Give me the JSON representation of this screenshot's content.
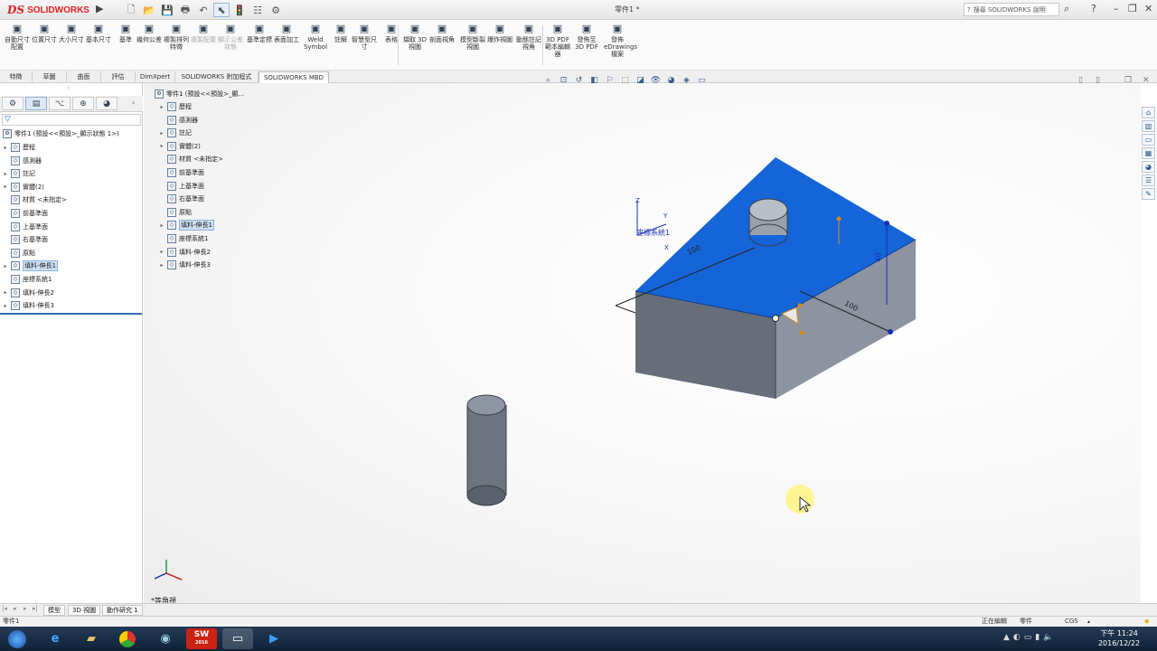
{
  "app": {
    "brand_ds": "DS",
    "brand_name": "SOLIDWORKS",
    "document_title": "零件1 *"
  },
  "search": {
    "placeholder": "搜尋 SOLIDWORKS 說明"
  },
  "command_manager": {
    "items": [
      {
        "label": "自動尺寸配置",
        "icon": "auto-dimension-icon",
        "enabled": true
      },
      {
        "label": "位置尺寸",
        "icon": "location-dimension-icon",
        "enabled": true
      },
      {
        "label": "大小尺寸",
        "icon": "size-dimension-icon",
        "enabled": true
      },
      {
        "label": "基本尺寸",
        "icon": "basic-dimension-icon",
        "enabled": true
      },
      {
        "label": "基準",
        "icon": "datum-icon",
        "enabled": true
      },
      {
        "label": "幾何公差",
        "icon": "geometric-tolerance-icon",
        "enabled": true
      },
      {
        "label": "複製排列特徵",
        "icon": "pattern-feature-icon",
        "enabled": true
      },
      {
        "label": "複製配置",
        "icon": "copy-scheme-icon",
        "enabled": false
      },
      {
        "label": "顯示公差狀態",
        "icon": "tolerance-status-icon",
        "enabled": false
      },
      {
        "label": "基準定標",
        "icon": "datum-target-icon",
        "enabled": true
      },
      {
        "label": "表面加工",
        "icon": "surface-finish-icon",
        "enabled": true
      },
      {
        "label": "Weld Symbol",
        "icon": "weld-symbol-icon",
        "enabled": true
      },
      {
        "label": "註解",
        "icon": "note-icon",
        "enabled": true
      },
      {
        "label": "智慧型尺寸",
        "icon": "smart-dimension-icon",
        "enabled": true
      },
      {
        "label": "表格",
        "icon": "table-icon",
        "enabled": true
      },
      {
        "label": "擷取 3D 視圖",
        "icon": "capture-3d-view-icon",
        "enabled": true
      },
      {
        "label": "剖面視角",
        "icon": "section-view-icon",
        "enabled": true
      },
      {
        "label": "模型斷裂視圖",
        "icon": "model-break-view-icon",
        "enabled": true
      },
      {
        "label": "爆炸視圖",
        "icon": "exploded-view-icon",
        "enabled": true
      },
      {
        "label": "動態註記視角",
        "icon": "dynamic-annotation-icon",
        "enabled": true
      },
      {
        "label": "3D PDF 範本編輯器",
        "icon": "pdf-template-editor-icon",
        "enabled": true
      },
      {
        "label": "發佈至 3D PDF",
        "icon": "publish-pdf-icon",
        "enabled": true
      },
      {
        "label": "發佈 eDrawings 檔案",
        "icon": "publish-edrawings-icon",
        "enabled": true
      }
    ]
  },
  "tabs": [
    "特徵",
    "草圖",
    "曲面",
    "評估",
    "DimXpert",
    "SOLIDWORKS 附加程式",
    "SOLIDWORKS MBD"
  ],
  "active_tab": "SOLIDWORKS MBD",
  "feature_tree": {
    "root": "零件1 (預設<<預設>_顯示狀態 1>)",
    "items": [
      {
        "label": "歷程",
        "icon": "history-icon",
        "expandable": true,
        "selected": false
      },
      {
        "label": "感測器",
        "icon": "sensor-icon",
        "expandable": false,
        "selected": false
      },
      {
        "label": "註記",
        "icon": "annotation-icon",
        "expandable": true,
        "selected": false
      },
      {
        "label": "實體(2)",
        "icon": "solid-bodies-icon",
        "expandable": true,
        "selected": false
      },
      {
        "label": "材質 <未指定>",
        "icon": "material-icon",
        "expandable": false,
        "selected": false
      },
      {
        "label": "前基準面",
        "icon": "plane-icon",
        "expandable": false,
        "selected": false
      },
      {
        "label": "上基準面",
        "icon": "plane-icon",
        "expandable": false,
        "selected": false
      },
      {
        "label": "右基準面",
        "icon": "plane-icon",
        "expandable": false,
        "selected": false
      },
      {
        "label": "原點",
        "icon": "origin-icon",
        "expandable": false,
        "selected": false
      },
      {
        "label": "填料-伸長1",
        "icon": "extrude-icon",
        "expandable": true,
        "selected": true
      },
      {
        "label": "座標系統1",
        "icon": "coordinate-system-icon",
        "expandable": false,
        "selected": false
      },
      {
        "label": "填料-伸長2",
        "icon": "extrude-icon",
        "expandable": true,
        "selected": false
      },
      {
        "label": "填料-伸長3",
        "icon": "extrude-icon",
        "expandable": true,
        "selected": false
      }
    ]
  },
  "flyout_tree": {
    "root": "零件1 (預設<<預設>_顯..."
  },
  "viewport": {
    "dimension_1": "100",
    "dimension_2": "100",
    "dimension_3": "40",
    "coord_label": "座標系統1",
    "axis_x": "X",
    "axis_y": "Y",
    "axis_z": "Z",
    "view_name": "*等角視",
    "colors": {
      "selected_face": "#1565d8",
      "body_side": "#6d7480",
      "body_front": "#8d93a0"
    }
  },
  "bottom_tabs": [
    "模型",
    "3D 視圖",
    "動作研究 1"
  ],
  "active_bottom_tab": "模型",
  "status": {
    "left": "零件1",
    "editing": "正在編輯",
    "type": "零件",
    "units": "CGS"
  },
  "taskbar": {
    "time": "下午 11:24",
    "date": "2016/12/22",
    "sw_badge": "2016"
  }
}
